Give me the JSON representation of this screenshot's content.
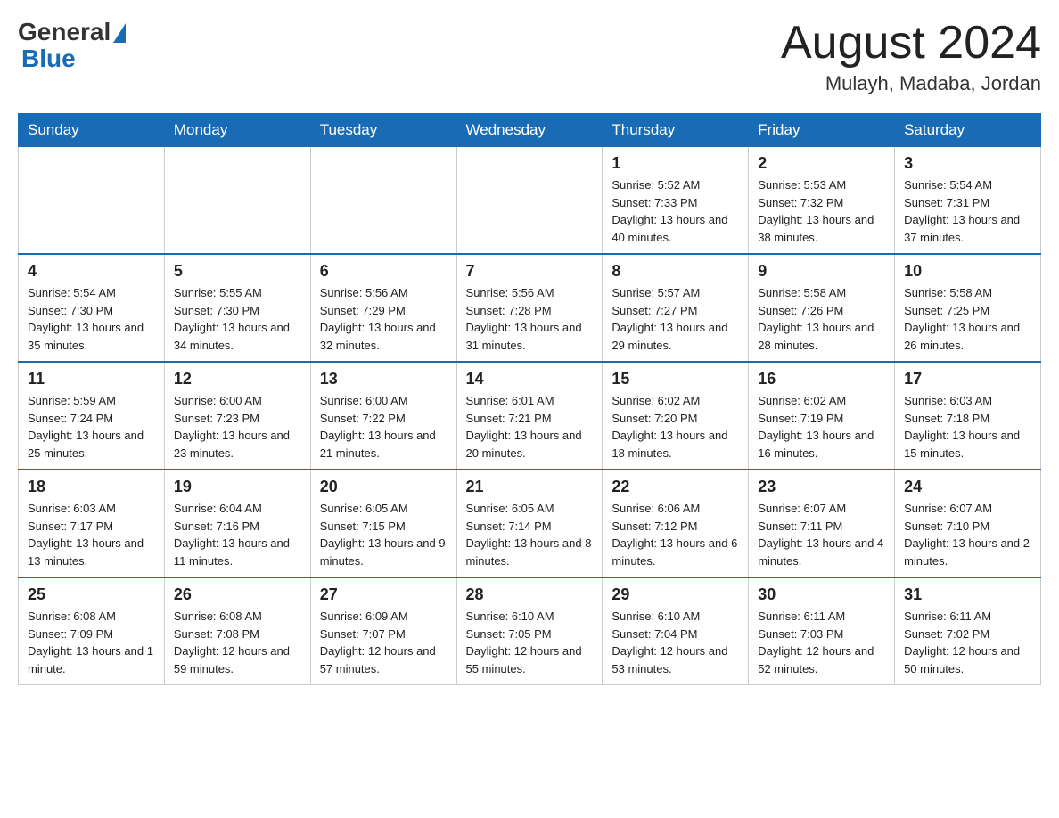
{
  "header": {
    "logo_general": "General",
    "logo_blue": "Blue",
    "title": "August 2024",
    "subtitle": "Mulayh, Madaba, Jordan"
  },
  "calendar": {
    "days_of_week": [
      "Sunday",
      "Monday",
      "Tuesday",
      "Wednesday",
      "Thursday",
      "Friday",
      "Saturday"
    ],
    "weeks": [
      [
        {
          "day": "",
          "info": ""
        },
        {
          "day": "",
          "info": ""
        },
        {
          "day": "",
          "info": ""
        },
        {
          "day": "",
          "info": ""
        },
        {
          "day": "1",
          "info": "Sunrise: 5:52 AM\nSunset: 7:33 PM\nDaylight: 13 hours and 40 minutes."
        },
        {
          "day": "2",
          "info": "Sunrise: 5:53 AM\nSunset: 7:32 PM\nDaylight: 13 hours and 38 minutes."
        },
        {
          "day": "3",
          "info": "Sunrise: 5:54 AM\nSunset: 7:31 PM\nDaylight: 13 hours and 37 minutes."
        }
      ],
      [
        {
          "day": "4",
          "info": "Sunrise: 5:54 AM\nSunset: 7:30 PM\nDaylight: 13 hours and 35 minutes."
        },
        {
          "day": "5",
          "info": "Sunrise: 5:55 AM\nSunset: 7:30 PM\nDaylight: 13 hours and 34 minutes."
        },
        {
          "day": "6",
          "info": "Sunrise: 5:56 AM\nSunset: 7:29 PM\nDaylight: 13 hours and 32 minutes."
        },
        {
          "day": "7",
          "info": "Sunrise: 5:56 AM\nSunset: 7:28 PM\nDaylight: 13 hours and 31 minutes."
        },
        {
          "day": "8",
          "info": "Sunrise: 5:57 AM\nSunset: 7:27 PM\nDaylight: 13 hours and 29 minutes."
        },
        {
          "day": "9",
          "info": "Sunrise: 5:58 AM\nSunset: 7:26 PM\nDaylight: 13 hours and 28 minutes."
        },
        {
          "day": "10",
          "info": "Sunrise: 5:58 AM\nSunset: 7:25 PM\nDaylight: 13 hours and 26 minutes."
        }
      ],
      [
        {
          "day": "11",
          "info": "Sunrise: 5:59 AM\nSunset: 7:24 PM\nDaylight: 13 hours and 25 minutes."
        },
        {
          "day": "12",
          "info": "Sunrise: 6:00 AM\nSunset: 7:23 PM\nDaylight: 13 hours and 23 minutes."
        },
        {
          "day": "13",
          "info": "Sunrise: 6:00 AM\nSunset: 7:22 PM\nDaylight: 13 hours and 21 minutes."
        },
        {
          "day": "14",
          "info": "Sunrise: 6:01 AM\nSunset: 7:21 PM\nDaylight: 13 hours and 20 minutes."
        },
        {
          "day": "15",
          "info": "Sunrise: 6:02 AM\nSunset: 7:20 PM\nDaylight: 13 hours and 18 minutes."
        },
        {
          "day": "16",
          "info": "Sunrise: 6:02 AM\nSunset: 7:19 PM\nDaylight: 13 hours and 16 minutes."
        },
        {
          "day": "17",
          "info": "Sunrise: 6:03 AM\nSunset: 7:18 PM\nDaylight: 13 hours and 15 minutes."
        }
      ],
      [
        {
          "day": "18",
          "info": "Sunrise: 6:03 AM\nSunset: 7:17 PM\nDaylight: 13 hours and 13 minutes."
        },
        {
          "day": "19",
          "info": "Sunrise: 6:04 AM\nSunset: 7:16 PM\nDaylight: 13 hours and 11 minutes."
        },
        {
          "day": "20",
          "info": "Sunrise: 6:05 AM\nSunset: 7:15 PM\nDaylight: 13 hours and 9 minutes."
        },
        {
          "day": "21",
          "info": "Sunrise: 6:05 AM\nSunset: 7:14 PM\nDaylight: 13 hours and 8 minutes."
        },
        {
          "day": "22",
          "info": "Sunrise: 6:06 AM\nSunset: 7:12 PM\nDaylight: 13 hours and 6 minutes."
        },
        {
          "day": "23",
          "info": "Sunrise: 6:07 AM\nSunset: 7:11 PM\nDaylight: 13 hours and 4 minutes."
        },
        {
          "day": "24",
          "info": "Sunrise: 6:07 AM\nSunset: 7:10 PM\nDaylight: 13 hours and 2 minutes."
        }
      ],
      [
        {
          "day": "25",
          "info": "Sunrise: 6:08 AM\nSunset: 7:09 PM\nDaylight: 13 hours and 1 minute."
        },
        {
          "day": "26",
          "info": "Sunrise: 6:08 AM\nSunset: 7:08 PM\nDaylight: 12 hours and 59 minutes."
        },
        {
          "day": "27",
          "info": "Sunrise: 6:09 AM\nSunset: 7:07 PM\nDaylight: 12 hours and 57 minutes."
        },
        {
          "day": "28",
          "info": "Sunrise: 6:10 AM\nSunset: 7:05 PM\nDaylight: 12 hours and 55 minutes."
        },
        {
          "day": "29",
          "info": "Sunrise: 6:10 AM\nSunset: 7:04 PM\nDaylight: 12 hours and 53 minutes."
        },
        {
          "day": "30",
          "info": "Sunrise: 6:11 AM\nSunset: 7:03 PM\nDaylight: 12 hours and 52 minutes."
        },
        {
          "day": "31",
          "info": "Sunrise: 6:11 AM\nSunset: 7:02 PM\nDaylight: 12 hours and 50 minutes."
        }
      ]
    ]
  }
}
